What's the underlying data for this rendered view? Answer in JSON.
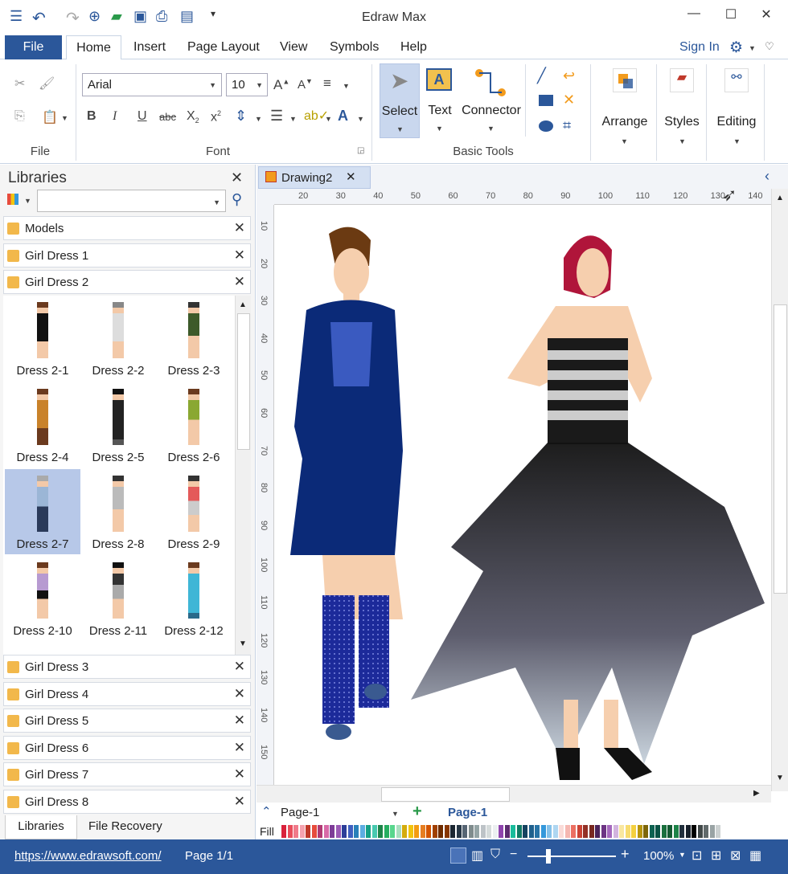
{
  "app": {
    "title": "Edraw Max"
  },
  "menu": {
    "file": "File",
    "home": "Home",
    "insert": "Insert",
    "page_layout": "Page Layout",
    "view": "View",
    "symbols": "Symbols",
    "help": "Help",
    "sign_in": "Sign In"
  },
  "ribbon": {
    "font_name": "Arial",
    "font_size": "10",
    "file_group": "File",
    "font_group": "Font",
    "basic_tools_group": "Basic Tools",
    "select": "Select",
    "text": "Text",
    "connector": "Connector",
    "arrange": "Arrange",
    "styles": "Styles",
    "editing": "Editing"
  },
  "libraries": {
    "title": "Libraries",
    "search_placeholder": "",
    "headers_top": [
      "Models",
      "Girl Dress 1",
      "Girl Dress 2"
    ],
    "items": [
      "Dress 2-1",
      "Dress 2-2",
      "Dress 2-3",
      "Dress 2-4",
      "Dress 2-5",
      "Dress 2-6",
      "Dress 2-7",
      "Dress 2-8",
      "Dress 2-9",
      "Dress 2-10",
      "Dress 2-11",
      "Dress 2-12"
    ],
    "headers_bottom": [
      "Girl Dress 3",
      "Girl Dress 4",
      "Girl Dress 5",
      "Girl Dress 6",
      "Girl Dress 7",
      "Girl Dress 8"
    ],
    "tabs": {
      "libraries": "Libraries",
      "file_recovery": "File Recovery"
    }
  },
  "document": {
    "tab": "Drawing2"
  },
  "ruler": {
    "h": [
      "20",
      "30",
      "40",
      "50",
      "60",
      "70",
      "80",
      "90",
      "100",
      "110",
      "120",
      "130",
      "140"
    ],
    "v": [
      "10",
      "20",
      "30",
      "40",
      "50",
      "60",
      "70",
      "80",
      "90",
      "100",
      "110",
      "120",
      "130",
      "140",
      "150"
    ]
  },
  "pages": {
    "current": "Page-1",
    "active_tab": "Page-1",
    "fill_label": "Fill"
  },
  "status": {
    "url": "https://www.edrawsoft.com/",
    "page": "Page 1/1",
    "zoom": "100%"
  },
  "colors": {
    "accent": "#2b579a",
    "ribbon_select": "#c9d7ee"
  }
}
